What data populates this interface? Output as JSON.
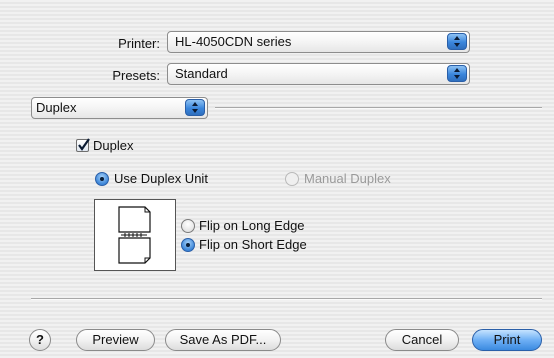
{
  "printer": {
    "label": "Printer:",
    "value": "HL-4050CDN series"
  },
  "presets": {
    "label": "Presets:",
    "value": "Standard"
  },
  "panel_selector": {
    "value": "Duplex"
  },
  "duplex_checkbox": {
    "label": "Duplex",
    "checked": true
  },
  "duplex_mode": {
    "use_unit": {
      "label": "Use Duplex Unit",
      "selected": true
    },
    "manual": {
      "label": "Manual Duplex",
      "selected": false,
      "enabled": false
    }
  },
  "binding": {
    "long_edge": {
      "label": "Flip on Long Edge",
      "selected": false
    },
    "short_edge": {
      "label": "Flip on Short Edge",
      "selected": true
    }
  },
  "buttons": {
    "help": "?",
    "preview": "Preview",
    "save_pdf": "Save As PDF...",
    "cancel": "Cancel",
    "print": "Print"
  },
  "colors": {
    "accent": "#3b8ae0",
    "disabled_text": "#9a9a9a"
  }
}
